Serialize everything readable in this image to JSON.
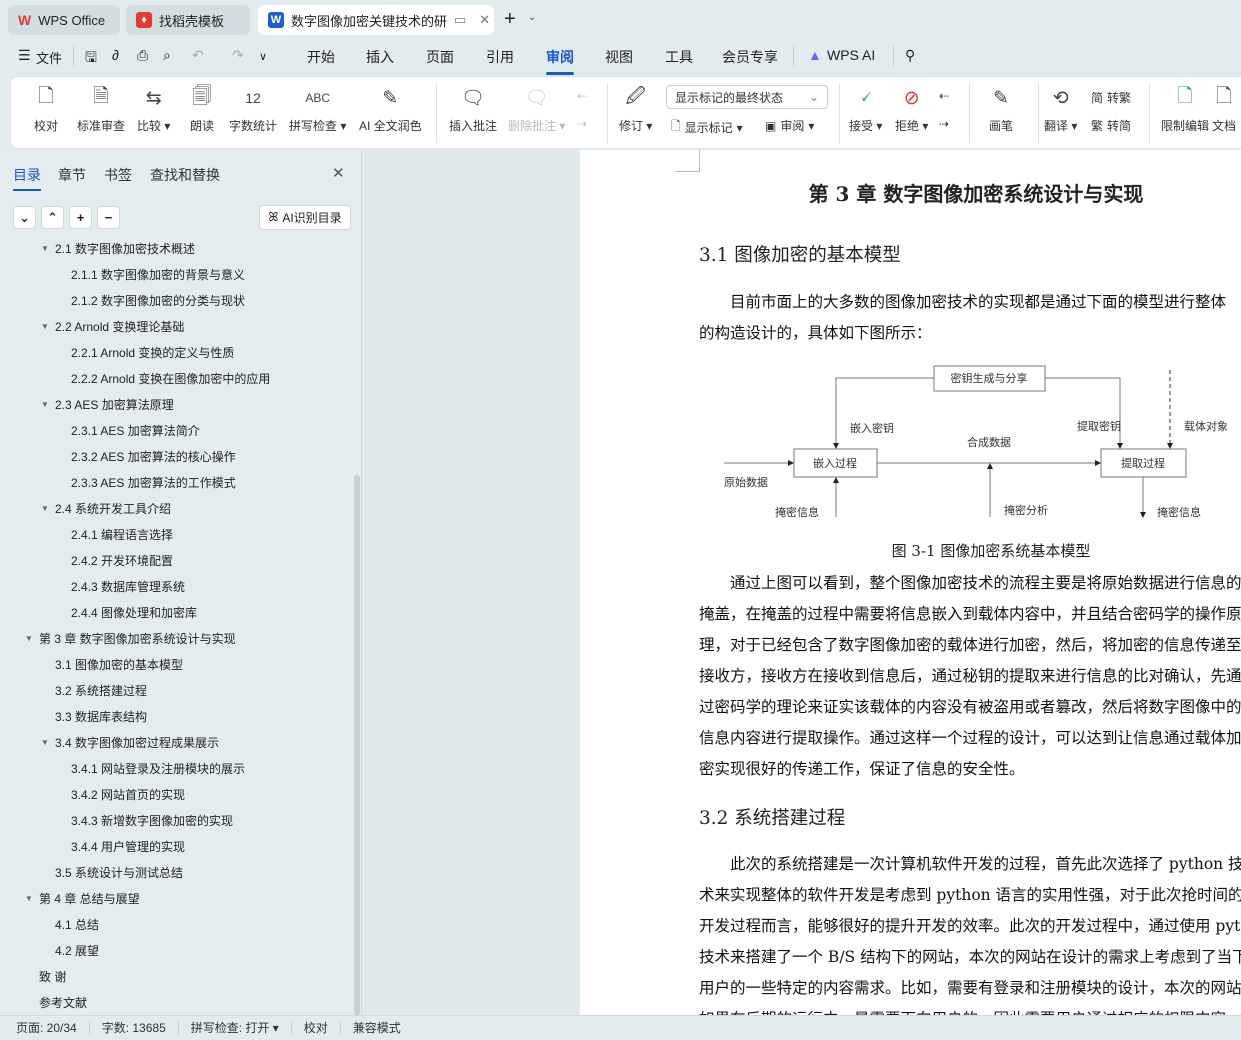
{
  "tabs": [
    {
      "label": "WPS Office",
      "icon": "wps-logo-icon"
    },
    {
      "label": "找稻壳模板",
      "icon": "docer-icon"
    },
    {
      "label": "数字图像加密关键技术的研究",
      "icon": "word-doc-icon"
    }
  ],
  "menu": {
    "file": "文件",
    "items": [
      "开始",
      "插入",
      "页面",
      "引用",
      "审阅",
      "视图",
      "工具",
      "会员专享"
    ],
    "active": "审阅",
    "ai": "WPS AI"
  },
  "ribbon": {
    "proofread": "校对",
    "standard_review": "标准审查",
    "compare": "比较",
    "read_aloud": "朗读",
    "word_count": "字数统计",
    "spell_check": "拼写检查",
    "ai_polish": "AI 全文润色",
    "insert_comment": "插入批注",
    "delete_comment": "删除批注",
    "track_changes": "修订",
    "markup_state": "显示标记的最终状态",
    "show_markup": "显示标记",
    "review_pane": "审阅",
    "accept": "接受",
    "reject": "拒绝",
    "pen": "画笔",
    "translate": "翻译",
    "to_traditional": "转繁",
    "to_simplified": "转简",
    "restrict_edit": "限制编辑",
    "doc_partial": "文档"
  },
  "sidebar": {
    "tabs": [
      "目录",
      "章节",
      "书签",
      "查找和替换"
    ],
    "ai_toc": "AI识别目录",
    "items": [
      {
        "label": "2.1  数字图像加密技术概述",
        "level": 2,
        "arrow": true
      },
      {
        "label": "2.1.1  数字图像加密的背景与意义",
        "level": 3
      },
      {
        "label": "2.1.2  数字图像加密的分类与现状",
        "level": 3
      },
      {
        "label": "2.2 Arnold 变换理论基础",
        "level": 2,
        "arrow": true
      },
      {
        "label": "2.2.1 Arnold 变换的定义与性质",
        "level": 3
      },
      {
        "label": "2.2.2 Arnold 变换在图像加密中的应用",
        "level": 3
      },
      {
        "label": "2.3 AES 加密算法原理",
        "level": 2,
        "arrow": true
      },
      {
        "label": "2.3.1 AES 加密算法简介",
        "level": 3
      },
      {
        "label": "2.3.2 AES 加密算法的核心操作",
        "level": 3
      },
      {
        "label": "2.3.3 AES 加密算法的工作模式",
        "level": 3
      },
      {
        "label": "2.4  系统开发工具介绍",
        "level": 2,
        "arrow": true
      },
      {
        "label": "2.4.1  编程语言选择",
        "level": 3
      },
      {
        "label": "2.4.2  开发环境配置",
        "level": 3
      },
      {
        "label": "2.4.3  数据库管理系统",
        "level": 3
      },
      {
        "label": "2.4.4  图像处理和加密库",
        "level": 3
      },
      {
        "label": "第 3 章  数字图像加密系统设计与实现",
        "level": 1,
        "arrow": true
      },
      {
        "label": "3.1  图像加密的基本模型",
        "level": 2
      },
      {
        "label": "3.2  系统搭建过程",
        "level": 2
      },
      {
        "label": "3.3  数据库表结构",
        "level": 2
      },
      {
        "label": "3.4  数字图像加密过程成果展示",
        "level": 2,
        "arrow": true
      },
      {
        "label": "3.4.1 网站登录及注册模块的展示",
        "level": 3
      },
      {
        "label": "3.4.2 网站首页的实现",
        "level": 3
      },
      {
        "label": "3.4.3 新增数字图像加密的实现",
        "level": 3
      },
      {
        "label": "3.4.4 用户管理的实现",
        "level": 3
      },
      {
        "label": "3.5 系统设计与测试总结",
        "level": 2
      },
      {
        "label": "第 4 章  总结与展望",
        "level": 1,
        "arrow": true
      },
      {
        "label": "4.1  总结",
        "level": 2
      },
      {
        "label": "4.2  展望",
        "level": 2
      },
      {
        "label": "致    谢",
        "level": 1
      },
      {
        "label": "参考文献",
        "level": 1
      }
    ]
  },
  "doc": {
    "chapter": "第 3 章  数字图像加密系统设计与实现",
    "h31": "3.1  图像加密的基本模型",
    "p1": [
      "　　目前市面上的大多数的图像加密技术的实现都是通过下面的模型进行整体",
      "的构造设计的，具体如下图所示："
    ],
    "diagram": {
      "key_gen": "密钥生成与分享",
      "embed": "嵌入过程",
      "extract": "提取过程",
      "embed_key": "嵌入密钥",
      "extract_key": "提取密钥",
      "carrier": "载体对象",
      "composite": "合成数据",
      "original": "原始数据",
      "secret_in": "掩密信息",
      "analysis": "掩密分析",
      "secret_out": "掩密信息"
    },
    "caption": "图 3-1 图像加密系统基本模型",
    "p2": [
      "　　通过上图可以看到，整个图像加密技术的流程主要是将原始数据进行信息的",
      "掩盖，在掩盖的过程中需要将信息嵌入到载体内容中，并且结合密码学的操作原",
      "理，对于已经包含了数字图像加密的载体进行加密，然后，将加密的信息传递至",
      "接收方，接收方在接收到信息后，通过秘钥的提取来进行信息的比对确认，先通",
      "过密码学的理论来证实该载体的内容没有被盗用或者篡改，然后将数字图像中的",
      "信息内容进行提取操作。通过这样一个过程的设计，可以达到让信息通过载体加",
      "密实现很好的传递工作，保证了信息的安全性。"
    ],
    "h32": "3.2  系统搭建过程",
    "p3": [
      "　　此次的系统搭建是一次计算机软件开发的过程，首先此次选择了 python 技",
      "术来实现整体的软件开发是考虑到 python 语言的实用性强，对于此次抢时间的",
      "开发过程而言，能够很好的提升开发的效率。此次的开发过程中，通过使用 python",
      "技术来搭建了一个 B/S 结构下的网站，本次的网站在设计的需求上考虑到了当下",
      "用户的一些特定的内容需求。比如，需要有登录和注册模块的设计，本次的网站",
      "如果在后期的运行中，是需要面向用户的，因此需要用户通过相应的权限内容"
    ]
  },
  "status": {
    "page": "页面: 20/34",
    "words": "字数: 13685",
    "spell": "拼写检查: 打开",
    "proof": "校对",
    "compat": "兼容模式"
  },
  "colors": {
    "accent": "#1a56d6",
    "wps_red": "#e8392c"
  }
}
